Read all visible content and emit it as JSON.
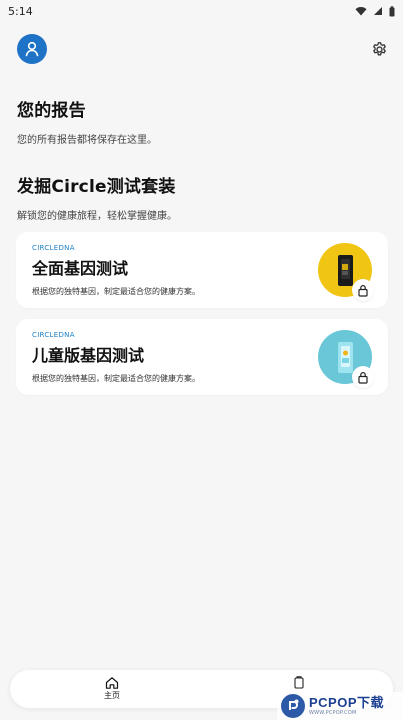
{
  "status_bar": {
    "time": "5:14",
    "icons": [
      "wifi-icon",
      "signal-icon",
      "battery-icon"
    ]
  },
  "header": {
    "avatar_icon": "user-icon",
    "settings_icon": "gear-icon"
  },
  "reports": {
    "title": "您的报告",
    "description": "您的所有报告都将保存在这里。"
  },
  "discover": {
    "title": "发掘Circle测试套装",
    "description": "解锁您的健康旅程，轻松掌握健康。"
  },
  "cards": [
    {
      "brand": "CIRCLEDNA",
      "title": "全面基因测试",
      "description": "根据您的独特基因，制定最适合您的健康方案。",
      "image_color": "#f1c514",
      "icon": "lock-icon"
    },
    {
      "brand": "CIRCLEDNA",
      "title": "儿童版基因测试",
      "description": "根据您的独特基因，制定最适合您的健康方案。",
      "image_color": "#69c7d8",
      "icon": "lock-icon"
    }
  ],
  "bottom_nav": {
    "home_label": "主页",
    "home_icon": "home-icon",
    "second_icon": "kit-icon"
  },
  "watermark": {
    "brand": "PCPOP下载",
    "sub": "WWW.PCPOP.COM"
  }
}
